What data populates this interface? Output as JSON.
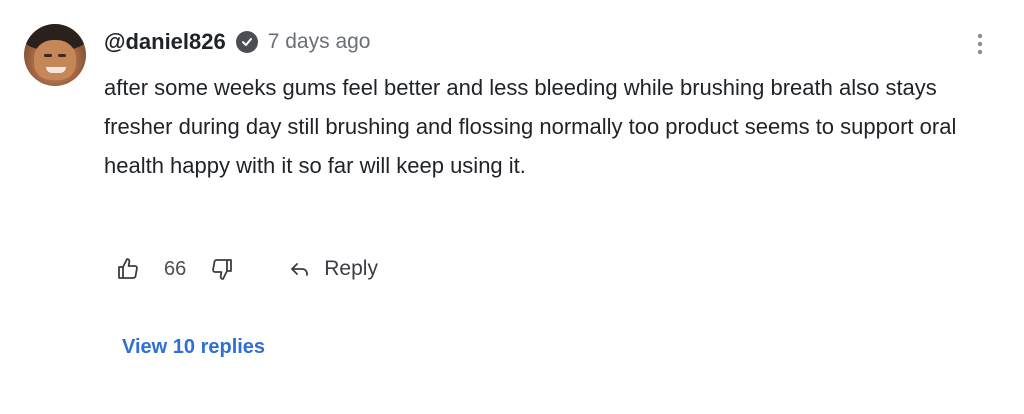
{
  "comment": {
    "author": "@daniel826",
    "verified_icon": "check-badge-icon",
    "timestamp": "7 days ago",
    "body": "after some weeks gums feel better and less bleeding while brushing breath also stays fresher during day still brushing and flossing normally too product seems to support oral health happy with it so far will keep using it.",
    "like_count": "66",
    "reply_label": "Reply",
    "view_replies_label": "View 10 replies"
  },
  "icons": {
    "like": "thumbs-up-icon",
    "dislike": "thumbs-down-icon",
    "reply": "reply-arrow-icon",
    "more": "more-vertical-icon"
  },
  "colors": {
    "link": "#2f6fd6",
    "muted": "#6b6f76",
    "text": "#1f2328"
  }
}
